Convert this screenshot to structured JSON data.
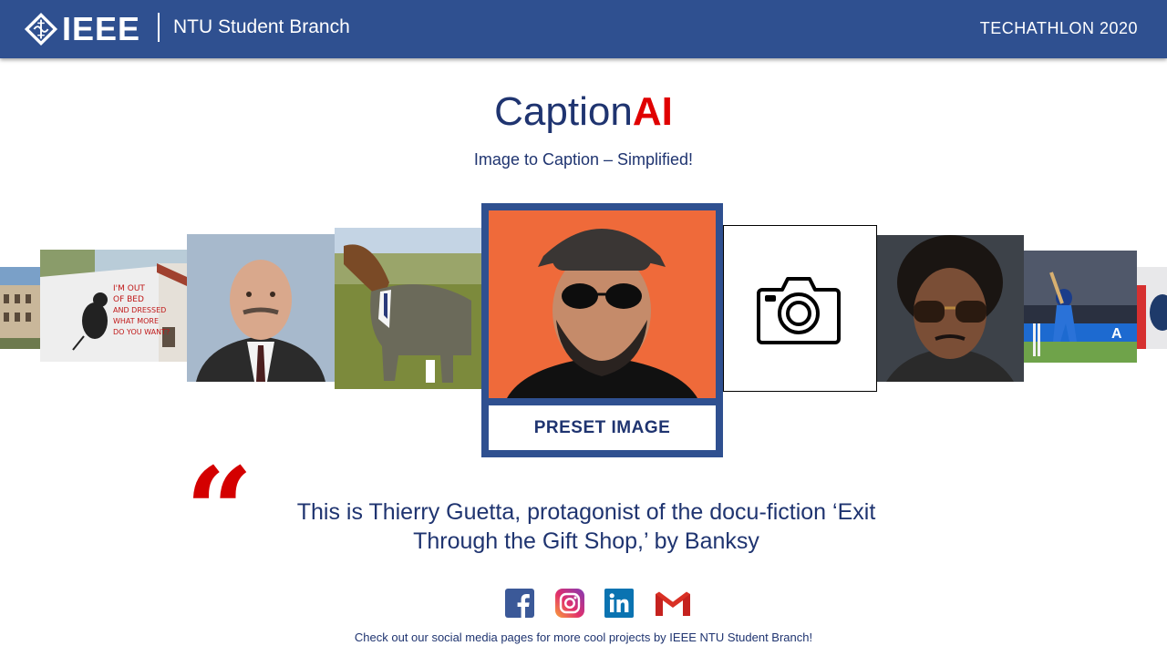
{
  "header": {
    "logo_text": "IEEE",
    "branch": "NTU Student Branch",
    "event": "TECHATHLON  2020",
    "bar_color": "#2f5090"
  },
  "title": {
    "main": "Caption",
    "accent": "AI",
    "accent_color": "#e00000",
    "subtitle": "Image to Caption – Simplified!"
  },
  "carousel": {
    "thumbnails": [
      "building-photo",
      "graffiti-rat-photo",
      "bald-man-photo",
      "horse-in-suit-photo",
      "bearded-man-photo",
      "camera-upload",
      "man-sunglasses-photo",
      "cricket-photo",
      "partial-photo"
    ],
    "preset_button": "PRESET IMAGE",
    "upload_icon": "camera-icon"
  },
  "caption": {
    "quote_icon": "quote-icon",
    "text": "This is Thierry Guetta, protagonist of the docu-fiction ‘Exit Through the Gift Shop,’ by Banksy"
  },
  "social": {
    "icons": [
      "facebook-icon",
      "instagram-icon",
      "linkedin-icon",
      "gmail-icon"
    ],
    "footer": "Check out our social media pages for more cool projects by IEEE NTU Student Branch!"
  }
}
